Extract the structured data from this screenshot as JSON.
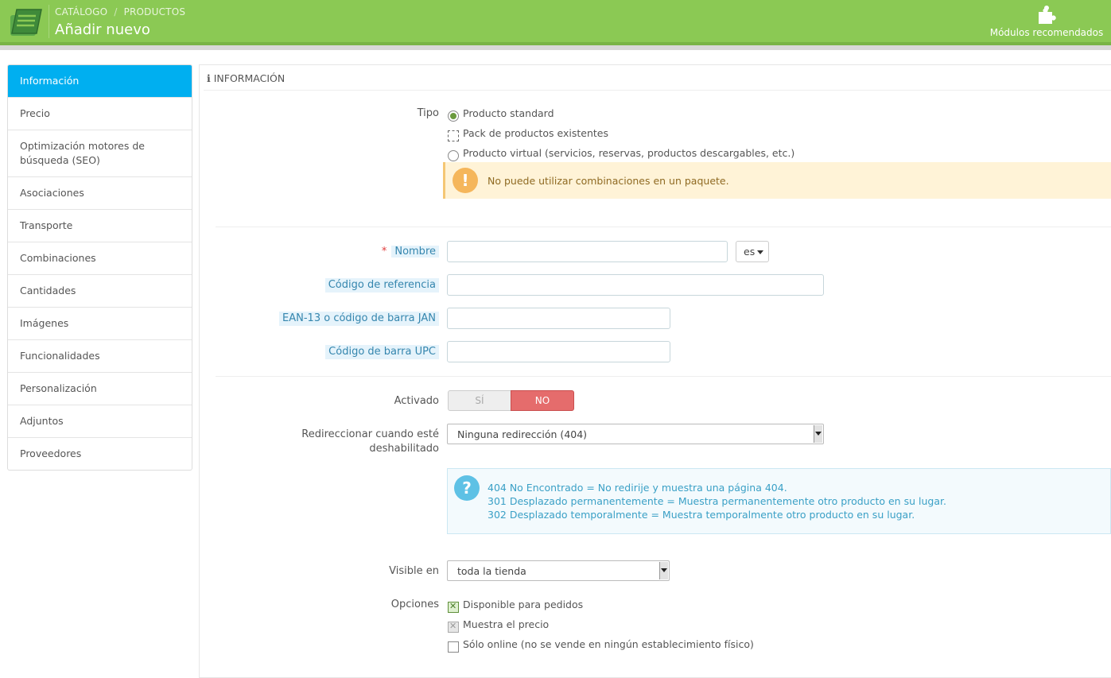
{
  "header": {
    "breadcrumb": [
      "CATÁLOGO",
      "PRODUCTOS"
    ],
    "breadcrumb_sep": "/",
    "title": "Añadir nuevo",
    "recommended_modules": "Módulos recomendados",
    "bar_color": "#8bc954",
    "icons": {
      "logo": "catalog-book-icon",
      "modules": "puzzle-icon"
    }
  },
  "sidebar": {
    "items": [
      {
        "label": "Información",
        "active": true
      },
      {
        "label": "Precio"
      },
      {
        "label": "Optimización motores de búsqueda (SEO)"
      },
      {
        "label": "Asociaciones"
      },
      {
        "label": "Transporte"
      },
      {
        "label": "Combinaciones"
      },
      {
        "label": "Cantidades"
      },
      {
        "label": "Imágenes"
      },
      {
        "label": "Funcionalidades"
      },
      {
        "label": "Personalización"
      },
      {
        "label": "Adjuntos"
      },
      {
        "label": "Proveedores"
      }
    ],
    "active_color": "#00aff0"
  },
  "panel": {
    "icon": "info-icon",
    "title": "INFORMACIÓN",
    "tipo": {
      "label": "Tipo",
      "options": [
        {
          "label": "Producto standard",
          "selected": true
        },
        {
          "label": "Pack de productos existentes",
          "selected": false
        },
        {
          "label": "Producto virtual (servicios, reservas, productos descargables, etc.)",
          "selected": false
        }
      ],
      "warning": "No puede utilizar combinaciones en un paquete.",
      "warning_icon": "exclamation-icon"
    },
    "nombre": {
      "required_mark": "*",
      "label": "Nombre",
      "value": "",
      "lang": "es"
    },
    "referencia": {
      "label": "Código de referencia",
      "value": ""
    },
    "ean": {
      "label": "EAN-13 o código de barra JAN",
      "value": ""
    },
    "upc": {
      "label": "Código de barra UPC",
      "value": ""
    },
    "activado": {
      "label": "Activado",
      "yes": "SÍ",
      "no": "NO",
      "value": "NO"
    },
    "redireccion": {
      "label_line1": "Redireccionar cuando esté",
      "label_line2": "deshabilitado",
      "selected": "Ninguna redirección (404)",
      "help_icon": "question-icon",
      "help": [
        "404 No Encontrado = No redirije y muestra una página 404.",
        "301 Desplazado permanentemente = Muestra permanentemente otro producto en su lugar.",
        "302 Desplazado temporalmente = Muestra temporalmente otro producto en su lugar."
      ]
    },
    "visible": {
      "label": "Visible en",
      "selected": "toda la tienda"
    },
    "opciones": {
      "label": "Opciones",
      "items": [
        {
          "label": "Disponible para pedidos",
          "checked": true
        },
        {
          "label": "Muestra el precio",
          "checked": true,
          "disabled": true
        },
        {
          "label": "Sólo online (no se vende en ningún establecimiento físico)",
          "checked": false
        }
      ]
    }
  }
}
